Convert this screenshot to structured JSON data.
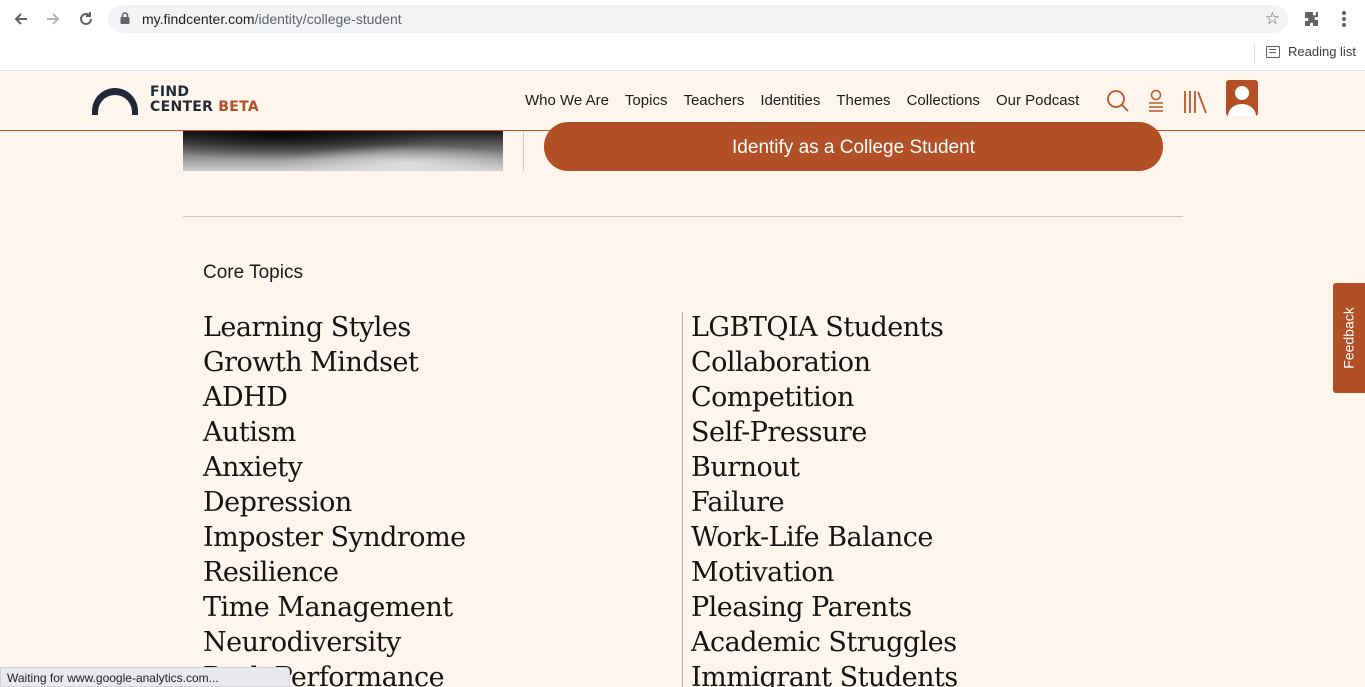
{
  "browser": {
    "url_domain": "my.findcenter.com",
    "url_path": "/identity/college-student",
    "reading_list_label": "Reading list",
    "status_text": "Waiting for www.google-analytics.com..."
  },
  "header": {
    "logo_line1": "FIND",
    "logo_line2": "CENTER",
    "logo_beta": "BETA",
    "nav": [
      "Who We Are",
      "Topics",
      "Teachers",
      "Identities",
      "Themes",
      "Collections",
      "Our Podcast"
    ]
  },
  "main": {
    "identify_button": "Identify as a College Student",
    "core_topics_title": "Core Topics",
    "left_topics": [
      "Learning Styles",
      "Growth Mindset",
      "ADHD",
      "Autism",
      "Anxiety",
      "Depression",
      "Imposter Syndrome",
      "Resilience",
      "Time Management",
      "Neurodiversity",
      "Peak Performance"
    ],
    "right_topics": [
      "LGBTQIA Students",
      "Collaboration",
      "Competition",
      "Self-Pressure",
      "Burnout",
      "Failure",
      "Work-Life Balance",
      "Motivation",
      "Pleasing Parents",
      "Academic Struggles",
      "Immigrant Students"
    ]
  },
  "feedback_label": "Feedback",
  "colors": {
    "accent": "#b24f26",
    "background": "#fef6ec"
  }
}
